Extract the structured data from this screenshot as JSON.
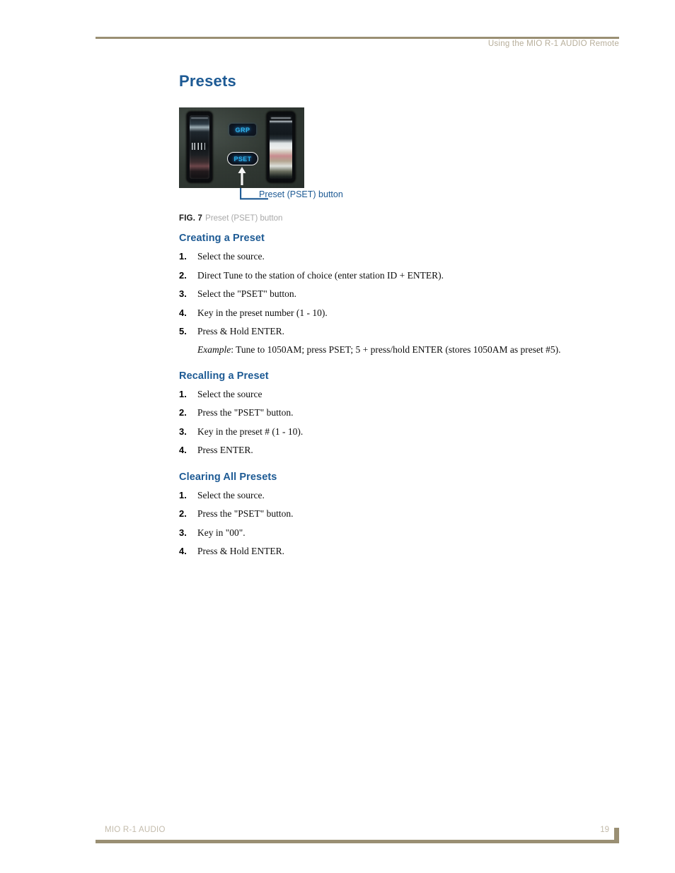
{
  "header": {
    "running_head": "Using the MIO R-1 AUDIO Remote",
    "rule_color": "#9a8f73",
    "text_color": "#b7ae9a"
  },
  "chapter": {
    "title": "Presets",
    "title_color": "#1d5a94"
  },
  "figure": {
    "callout_label": "Preset (PSET) button",
    "callout_color": "#1d5a94",
    "caption_number": "FIG. 7",
    "caption_text": "Preset (PSET) button",
    "photo": {
      "description": "close-up photo of remote control keypad",
      "buttons": [
        {
          "label": "GRP",
          "name": "grp-button",
          "text_color": "#2bb7ef"
        },
        {
          "label": "PSET",
          "name": "pset-button",
          "text_color": "#29b4ef",
          "highlighted": true
        }
      ]
    }
  },
  "sections": [
    {
      "heading": "Creating a Preset",
      "steps": [
        {
          "num": "1.",
          "text": "Select the source."
        },
        {
          "num": "2.",
          "text": "Direct Tune to the station of choice (enter station ID + ENTER)."
        },
        {
          "num": "3.",
          "text": "Select the \"PSET\" button."
        },
        {
          "num": "4.",
          "text": "Key in the preset number (1 - 10)."
        },
        {
          "num": "5.",
          "text": "Press & Hold ENTER."
        }
      ],
      "example": {
        "word": "Example",
        "rest": ": Tune to 1050AM; press PSET; 5 + press/hold ENTER (stores 1050AM as preset #5)."
      }
    },
    {
      "heading": "Recalling a Preset",
      "steps": [
        {
          "num": "1.",
          "text": "Select the source"
        },
        {
          "num": "2.",
          "text": "Press the \"PSET\" button."
        },
        {
          "num": "3.",
          "text": "Key in the preset # (1 - 10)."
        },
        {
          "num": "4.",
          "text": "Press ENTER."
        }
      ]
    },
    {
      "heading": "Clearing All Presets",
      "steps": [
        {
          "num": "1.",
          "text": "Select the source."
        },
        {
          "num": "2.",
          "text": "Press the \"PSET\" button."
        },
        {
          "num": "3.",
          "text": "Key in \"00\"."
        },
        {
          "num": "4.",
          "text": "Press & Hold ENTER."
        }
      ]
    }
  ],
  "footer": {
    "manual_name": "MIO R-1 AUDIO",
    "page_number": "19",
    "rule_color": "#9a8f73",
    "text_color": "#c3bbab"
  }
}
